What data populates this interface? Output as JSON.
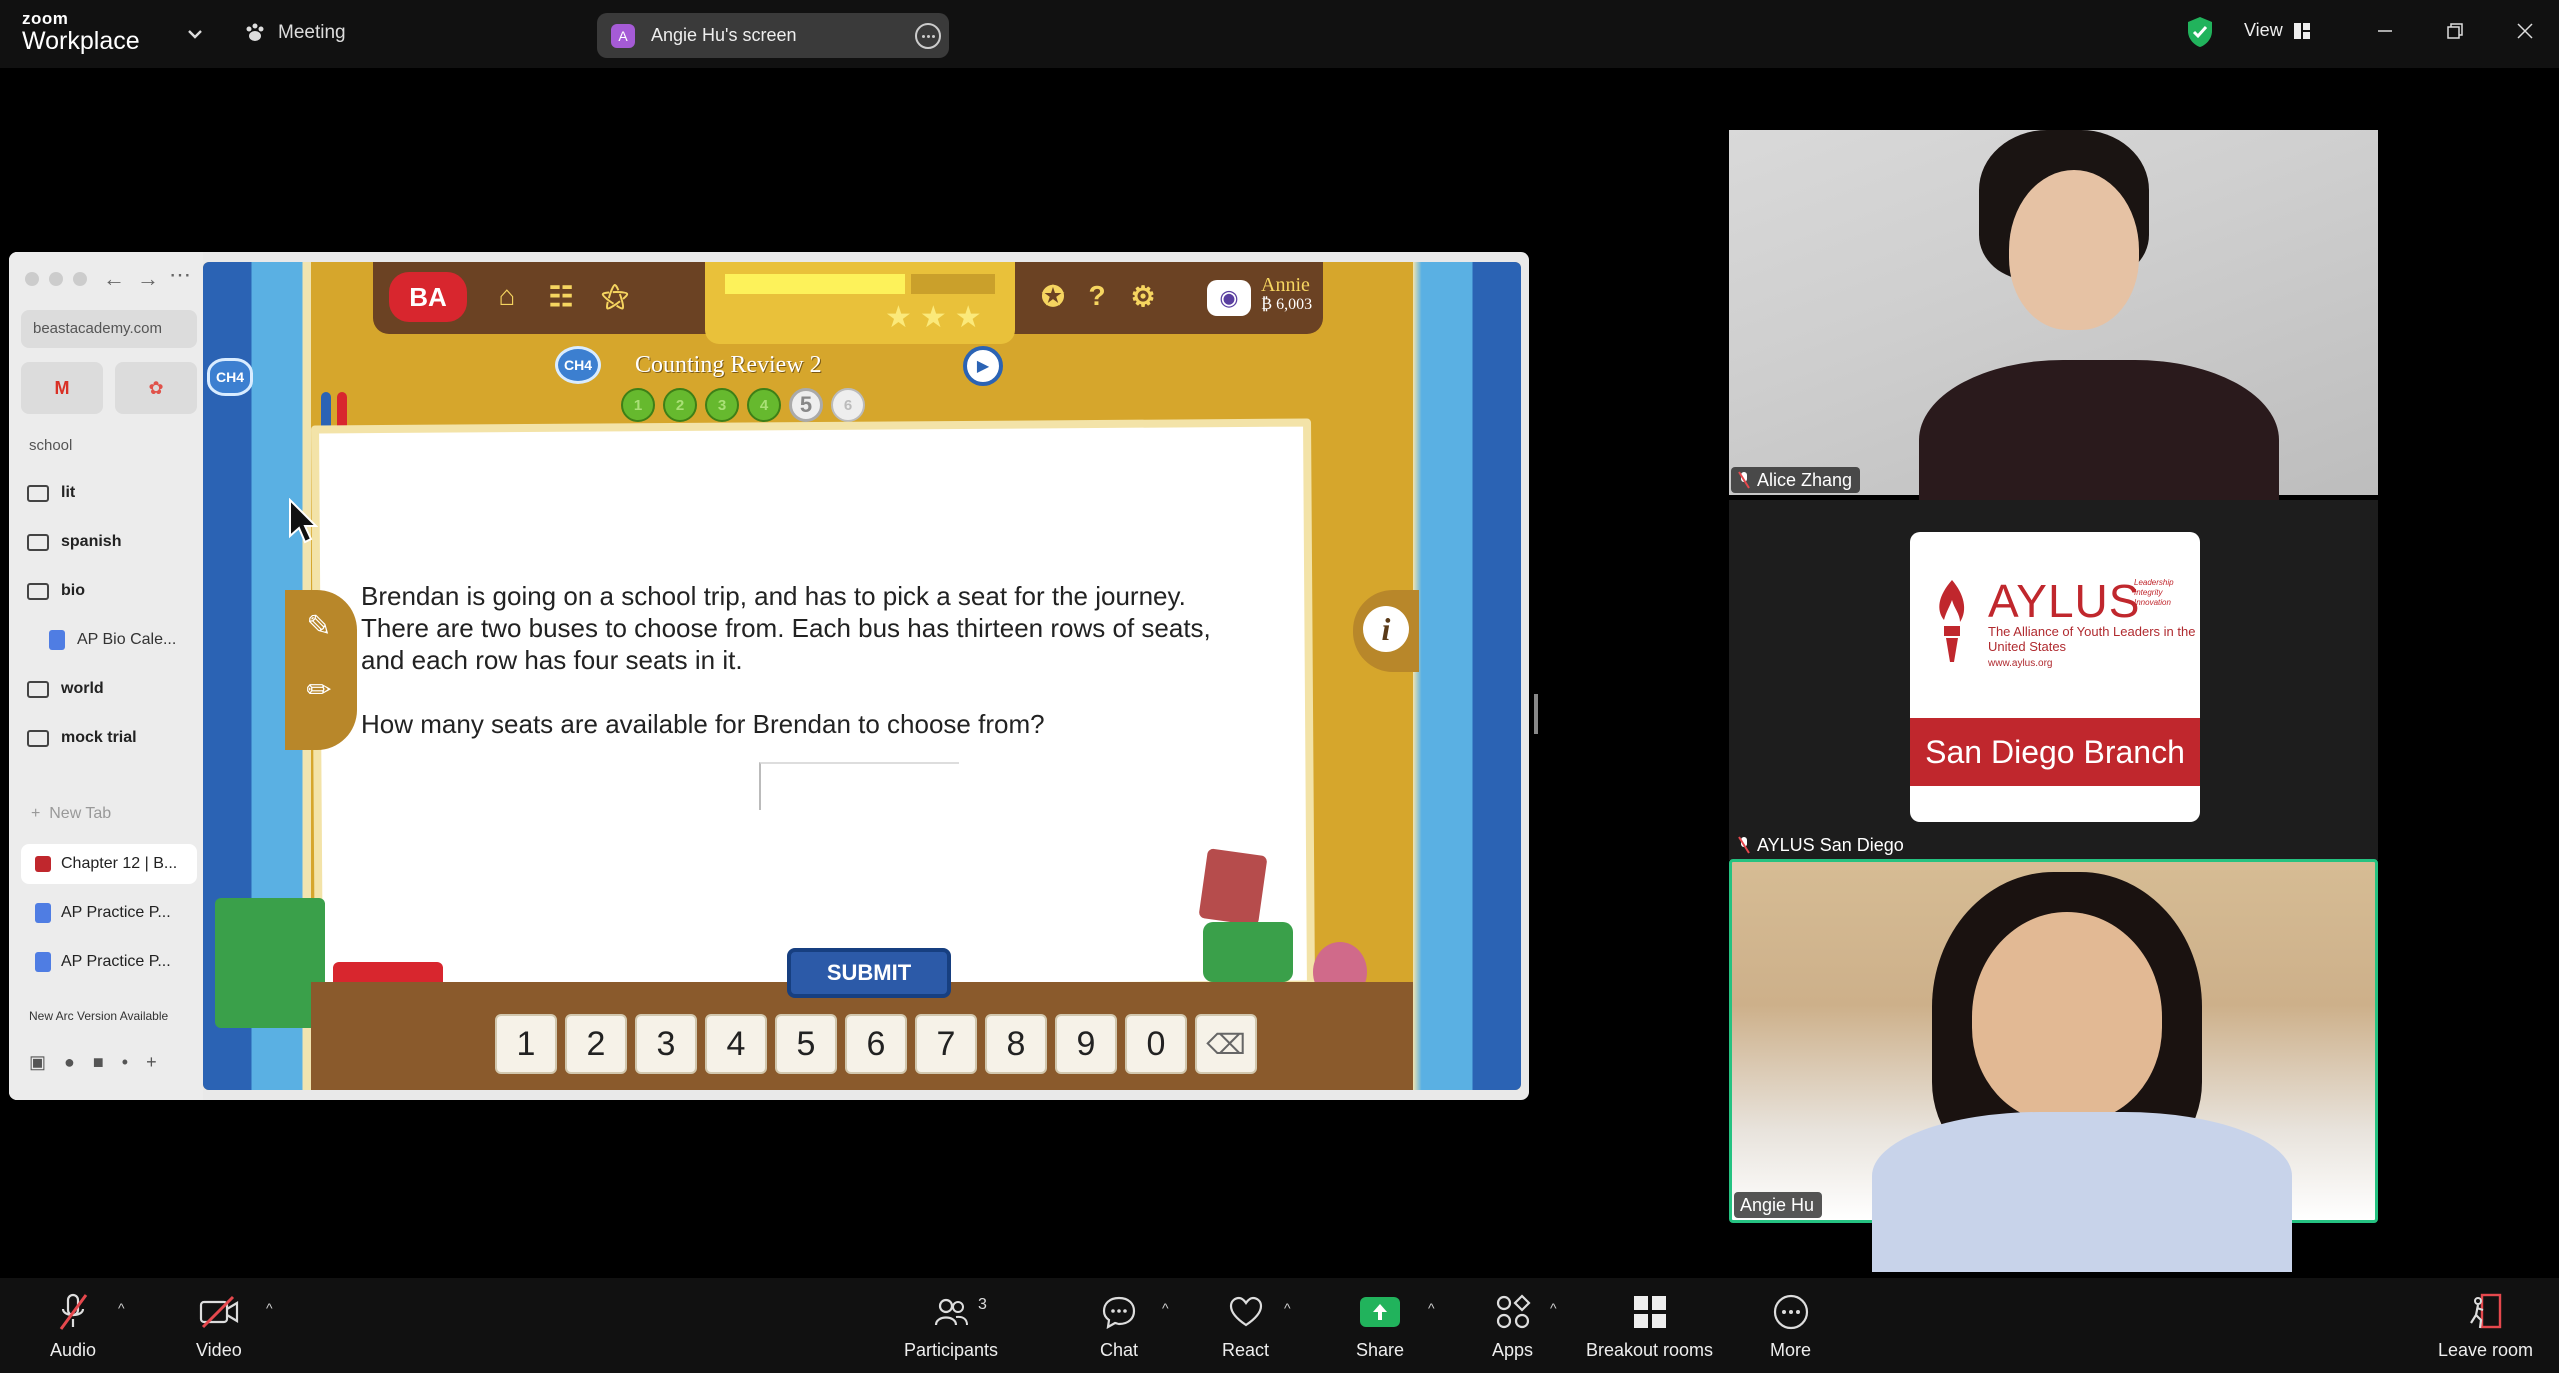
{
  "topbar": {
    "logo_top": "zoom",
    "logo_bottom": "Workplace",
    "meeting_label": "Meeting",
    "screen_avatar": "A",
    "screen_label": "Angie Hu's screen",
    "view_label": "View"
  },
  "browser": {
    "url": "beastacademy.com",
    "section": "school",
    "folders": [
      {
        "label": "lit",
        "icon": "folder-icon"
      },
      {
        "label": "spanish",
        "icon": "folder-icon"
      },
      {
        "label": "bio",
        "icon": "folder-open-icon"
      },
      {
        "label": "AP Bio Cale...",
        "icon": "doc-icon"
      },
      {
        "label": "world",
        "icon": "folder-open-icon"
      },
      {
        "label": "mock trial",
        "icon": "folder-icon"
      }
    ],
    "new_tab": "New Tab",
    "tabs": [
      {
        "label": "Chapter 12 | B...",
        "icon": "ba-icon"
      },
      {
        "label": "AP Practice P...",
        "icon": "doc-icon"
      },
      {
        "label": "AP Practice P...",
        "icon": "doc-icon"
      }
    ],
    "new_arc": "New Arc Version Available"
  },
  "game": {
    "logo": "BA",
    "chapter_badge": "CH4",
    "chapter_badge_left": "CH4",
    "title": "Counting Review 2",
    "user": "Annie",
    "coins": "₿ 6,003",
    "progress": [
      "1",
      "2",
      "3",
      "4",
      "5",
      "6"
    ],
    "current_problem": 5,
    "question_p1": "Brendan is going on a school trip, and has to pick a seat for the journey. There are two buses to choose from. Each bus has thirteen rows of seats, and each row has four seats in it.",
    "question_p2": "How many seats are available for Brendan to choose from?",
    "submit": "SUBMIT",
    "keys": [
      "1",
      "2",
      "3",
      "4",
      "5",
      "6",
      "7",
      "8",
      "9",
      "0"
    ],
    "info": "i"
  },
  "participants": {
    "tile1": {
      "name": "Alice Zhang"
    },
    "tile2": {
      "name": "AYLUS San Diego",
      "logo_title": "AYLUS",
      "logo_tag": "Leadership Integrity Innovation",
      "logo_sub": "The Alliance of Youth Leaders in the United States",
      "logo_url": "www.aylus.org",
      "logo_band": "San Diego Branch"
    },
    "tile3": {
      "name": "Angie Hu"
    }
  },
  "toolbar": {
    "audio": "Audio",
    "video": "Video",
    "participants": "Participants",
    "participants_count": "3",
    "chat": "Chat",
    "react": "React",
    "share": "Share",
    "apps": "Apps",
    "breakout": "Breakout rooms",
    "more": "More",
    "leave": "Leave room"
  },
  "colors": {
    "active_speaker": "#25c281",
    "share_green": "#21b35c",
    "aylus_red": "#c0272d",
    "curtain_blue": "#2b63b4"
  }
}
